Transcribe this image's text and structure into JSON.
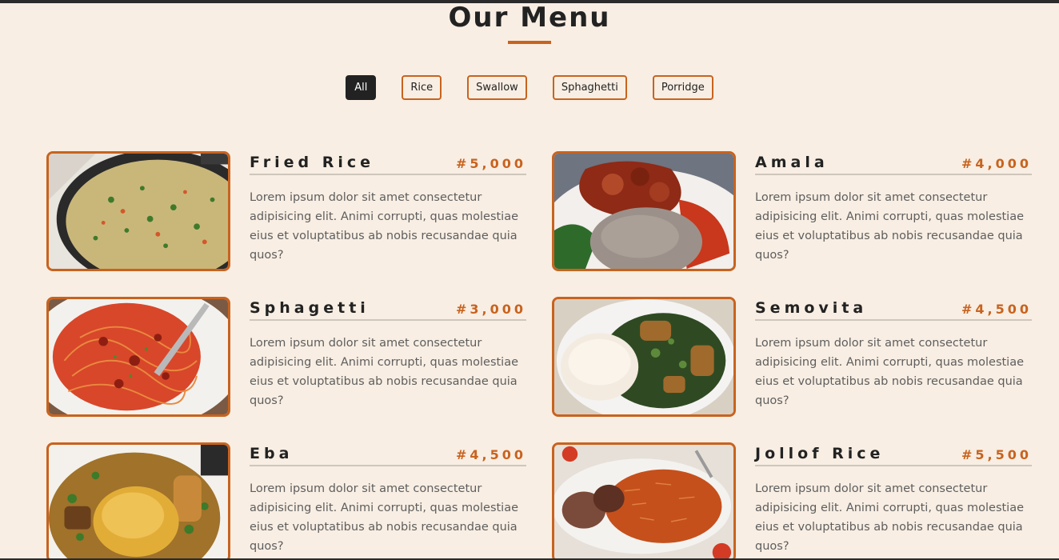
{
  "page": {
    "title": "Our Menu",
    "accent_color": "#c8631f",
    "background_color": "#f8eee3"
  },
  "filters": [
    {
      "label": "All",
      "active": true
    },
    {
      "label": "Rice",
      "active": false
    },
    {
      "label": "Swallow",
      "active": false
    },
    {
      "label": "Sphaghetti",
      "active": false
    },
    {
      "label": "Porridge",
      "active": false
    }
  ],
  "menu_items": [
    {
      "name": "Fried Rice",
      "price": "#5,000",
      "description": "Lorem ipsum dolor sit amet consectetur adipisicing elit. Animi corrupti, quas molestiae eius et voluptatibus ab nobis recusandae quia quos?",
      "image": "fried-rice-photo"
    },
    {
      "name": "Amala",
      "price": "#4,000",
      "description": "Lorem ipsum dolor sit amet consectetur adipisicing elit. Animi corrupti, quas molestiae eius et voluptatibus ab nobis recusandae quia quos?",
      "image": "amala-photo"
    },
    {
      "name": "Sphagetti",
      "price": "#3,000",
      "description": "Lorem ipsum dolor sit amet consectetur adipisicing elit. Animi corrupti, quas molestiae eius et voluptatibus ab nobis recusandae quia quos?",
      "image": "spaghetti-photo"
    },
    {
      "name": "Semovita",
      "price": "#4,500",
      "description": "Lorem ipsum dolor sit amet consectetur adipisicing elit. Animi corrupti, quas molestiae eius et voluptatibus ab nobis recusandae quia quos?",
      "image": "semovita-photo"
    },
    {
      "name": "Eba",
      "price": "#4,500",
      "description": "Lorem ipsum dolor sit amet consectetur adipisicing elit. Animi corrupti, quas molestiae eius et voluptatibus ab nobis recusandae quia quos?",
      "image": "eba-photo"
    },
    {
      "name": "Jollof Rice",
      "price": "#5,500",
      "description": "Lorem ipsum dolor sit amet consectetur adipisicing elit. Animi corrupti, quas molestiae eius et voluptatibus ab nobis recusandae quia quos?",
      "image": "jollof-rice-photo"
    }
  ]
}
